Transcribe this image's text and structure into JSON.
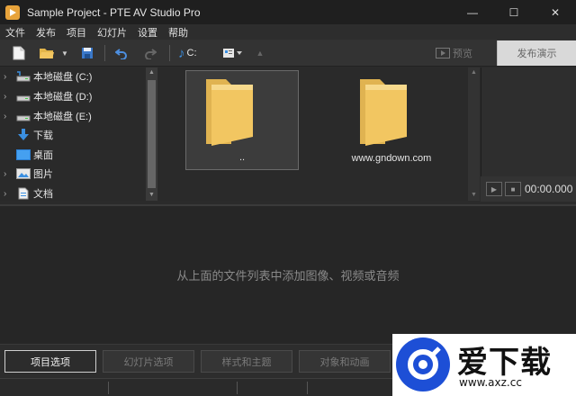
{
  "window": {
    "title": "Sample Project - PTE AV Studio Pro",
    "controls": [
      "—",
      "☐",
      "✕"
    ]
  },
  "menu": [
    "文件",
    "发布",
    "项目",
    "幻灯片",
    "设置",
    "帮助"
  ],
  "toolbar": {
    "drive_label": "C:",
    "preview_label": "预览",
    "publish_label": "发布演示"
  },
  "tree": [
    {
      "label": "本地磁盘 (C:)",
      "icon": "drive-icon",
      "expandable": true
    },
    {
      "label": "本地磁盘 (D:)",
      "icon": "drive-icon",
      "expandable": true
    },
    {
      "label": "本地磁盘 (E:)",
      "icon": "drive-icon",
      "expandable": true
    },
    {
      "label": "下载",
      "icon": "download-icon",
      "expandable": false
    },
    {
      "label": "桌面",
      "icon": "desktop-icon",
      "expandable": false
    },
    {
      "label": "图片",
      "icon": "pictures-icon",
      "expandable": true
    },
    {
      "label": "文档",
      "icon": "documents-icon",
      "expandable": true
    }
  ],
  "files": [
    {
      "caption": "..",
      "icon": "folder-icon",
      "selected": true
    },
    {
      "caption": "www.gndown.com",
      "icon": "folder-icon",
      "selected": false
    }
  ],
  "player": {
    "time": "00:00.000"
  },
  "timeline": {
    "empty_message": "从上面的文件列表中添加图像、视频或音频"
  },
  "bottom_buttons": [
    {
      "label": "项目选项",
      "active": true
    },
    {
      "label": "幻灯片选项",
      "active": false
    },
    {
      "label": "样式和主题",
      "active": false
    },
    {
      "label": "对象和动画",
      "active": false
    }
  ],
  "watermark": {
    "title": "爱下载",
    "url": "www.axz.cc"
  },
  "colors": {
    "folder": "#f2c661",
    "accent_blue": "#1d4fd6",
    "music_blue": "#3b8fe0"
  }
}
